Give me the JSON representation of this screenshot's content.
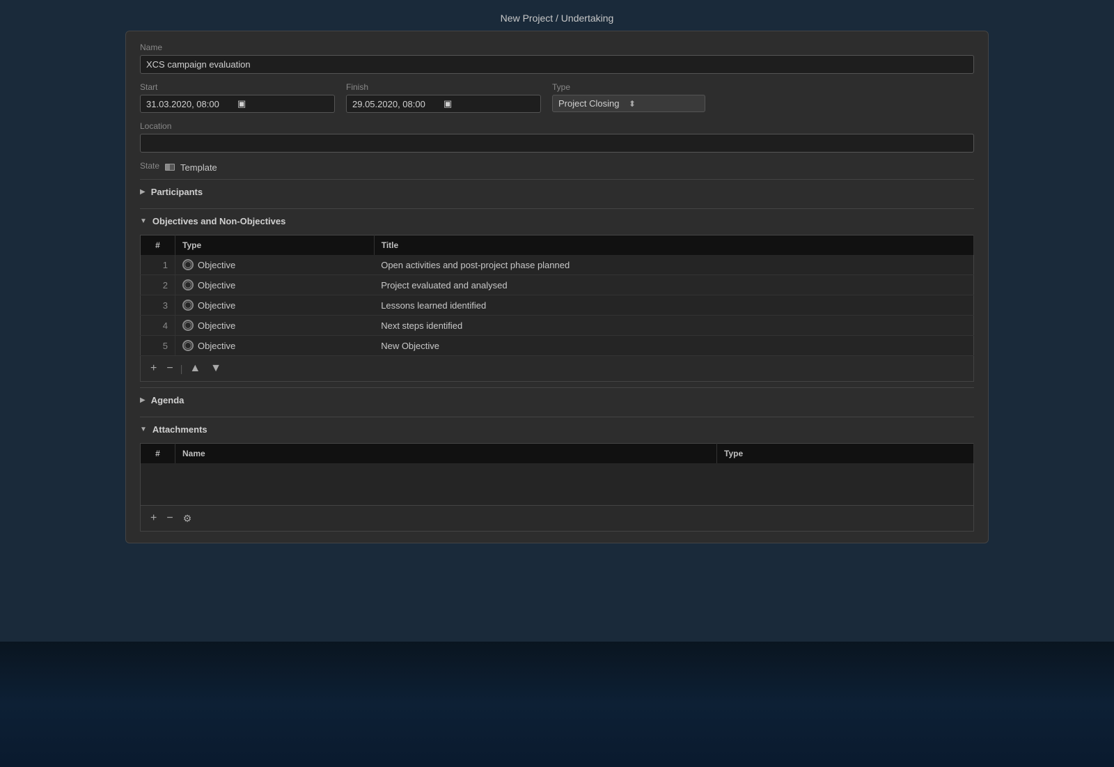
{
  "window": {
    "title": "New Project / Undertaking"
  },
  "form": {
    "name_label": "Name",
    "name_value": "XCS campaign evaluation",
    "start_label": "Start",
    "start_value": "31.03.2020, 08:00",
    "finish_label": "Finish",
    "finish_value": "29.05.2020, 08:00",
    "type_label": "Type",
    "type_value": "Project Closing",
    "location_label": "Location",
    "location_value": "",
    "state_label": "State",
    "state_value": "Template"
  },
  "sections": {
    "participants_label": "Participants",
    "objectives_label": "Objectives and Non-Objectives",
    "agenda_label": "Agenda",
    "attachments_label": "Attachments"
  },
  "objectives_table": {
    "col_number": "#",
    "col_type": "Type",
    "col_title": "Title",
    "rows": [
      {
        "num": "1",
        "type": "Objective",
        "title": "Open activities and post-project phase planned"
      },
      {
        "num": "2",
        "type": "Objective",
        "title": "Project evaluated and analysed"
      },
      {
        "num": "3",
        "type": "Objective",
        "title": "Lessons learned identified"
      },
      {
        "num": "4",
        "type": "Objective",
        "title": "Next steps identified"
      },
      {
        "num": "5",
        "type": "Objective",
        "title": "New Objective"
      }
    ]
  },
  "attachments_table": {
    "col_number": "#",
    "col_name": "Name",
    "col_type": "Type"
  },
  "toolbar": {
    "add": "+",
    "remove": "−",
    "up": "▲",
    "down": "▼"
  }
}
